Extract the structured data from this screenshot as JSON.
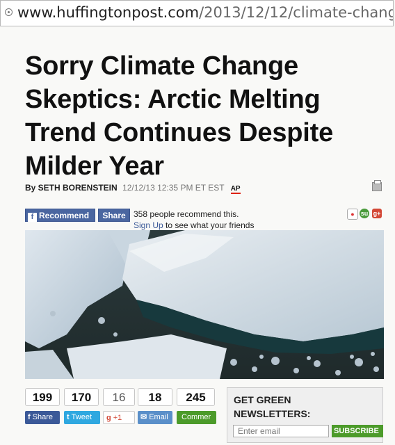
{
  "browser": {
    "url_domain": "www.huffingtonpost.com",
    "url_path": "/2013/12/12/climate-chang"
  },
  "article": {
    "headline": "Sorry Climate Change Skeptics: Arctic Melting Trend Continues Despite Milder Year",
    "byline_by": "By SETH BORENSTEIN",
    "timestamp": "12/12/13 12:35 PM ET EST",
    "source_badge": "AP"
  },
  "facebook": {
    "recommend_label": "Recommend",
    "share_label": "Share",
    "recommend_count_text": "358 people recommend this.",
    "signup_link": "Sign Up",
    "signup_rest": " to see what your friends"
  },
  "share_icons": [
    "reddit-icon",
    "stumbleupon-icon",
    "google-plus-icon"
  ],
  "share_bar": [
    {
      "count": "199",
      "label": "Share",
      "glyph": "f",
      "color": "#3b5998"
    },
    {
      "count": "170",
      "label": "Tweet",
      "glyph": "t",
      "color": "#2fa8e0"
    },
    {
      "count": "16",
      "label": "+1",
      "glyph": "g",
      "color": "#ffffff"
    },
    {
      "count": "18",
      "label": "Email",
      "glyph": "✉",
      "color": "#5a8fc9"
    },
    {
      "count": "245",
      "label": "Commer",
      "glyph": "",
      "color": "#4c9b2a"
    }
  ],
  "newsletter": {
    "title": "GET GREEN NEWSLETTERS:",
    "placeholder": "Enter email",
    "button_label": "SUBSCRIBE"
  }
}
